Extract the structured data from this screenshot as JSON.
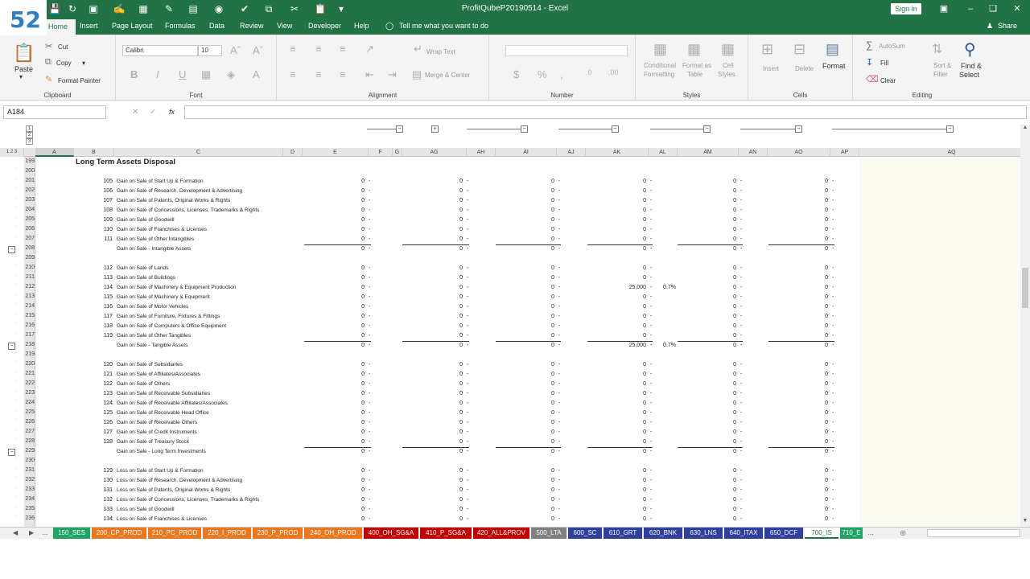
{
  "title": "ProfitQubeP20190514  -  Excel",
  "logo": "52",
  "signin_label": "Sign in",
  "share_label": "Share",
  "tell_me": "Tell me what you want to do",
  "ribbon_tabs": [
    "Home",
    "Insert",
    "Page Layout",
    "Formulas",
    "Data",
    "Review",
    "View",
    "Developer",
    "Help"
  ],
  "clipboard": {
    "paste": "Paste",
    "cut": "Cut",
    "copy": "Copy",
    "painter": "Format Painter",
    "label": "Clipboard"
  },
  "font": {
    "name": "Calibri",
    "size": "10",
    "label": "Font"
  },
  "alignment": {
    "wrap": "Wrap Text",
    "merge": "Merge & Center",
    "label": "Alignment"
  },
  "number": {
    "label": "Number"
  },
  "styles": {
    "cond": "Conditional",
    "cond2": "Formatting",
    "table": "Format as",
    "table2": "Table",
    "cell": "Cell",
    "cell2": "Styles",
    "label": "Styles"
  },
  "cells": {
    "insert": "Insert",
    "delete": "Delete",
    "format": "Format",
    "label": "Cells"
  },
  "editing": {
    "autosum": "AutoSum",
    "fill": "Fill",
    "clear": "Clear",
    "sort": "Sort &",
    "sort2": "Filter",
    "find": "Find &",
    "find2": "Select",
    "label": "Editing"
  },
  "namebox": "A184",
  "fx": "fx",
  "outline_levels_col": [
    "1",
    "2",
    "3"
  ],
  "outline_levels_row": [
    "1",
    "2",
    "3"
  ],
  "columns": [
    "A",
    "B",
    "C",
    "D",
    "E",
    "F",
    "G",
    "AG",
    "AH",
    "AI",
    "AJ",
    "AK",
    "AL",
    "AM",
    "AN",
    "AO",
    "AP",
    "AQ"
  ],
  "sheet_title": "Long Term Assets Disposal",
  "rows": [
    {
      "n": "199",
      "code": "",
      "label": "",
      "kind": "title"
    },
    {
      "n": "200",
      "code": "",
      "label": "",
      "kind": "blank"
    },
    {
      "n": "201",
      "code": "105",
      "label": "Gain on Sale of Start Up & Formation",
      "kind": "data"
    },
    {
      "n": "202",
      "code": "106",
      "label": "Gain on Sale of Research, Development & Advertising",
      "kind": "data"
    },
    {
      "n": "203",
      "code": "107",
      "label": "Gain on Sale of Patents, Original Works & Rights",
      "kind": "data"
    },
    {
      "n": "204",
      "code": "108",
      "label": "Gain on Sale of Concessions, Licenses, Trademarks & Rights",
      "kind": "data"
    },
    {
      "n": "205",
      "code": "109",
      "label": "Gain on Sale of Goodwill",
      "kind": "data"
    },
    {
      "n": "206",
      "code": "110",
      "label": "Gain on Sale of Franchises & Licenses",
      "kind": "data"
    },
    {
      "n": "207",
      "code": "111",
      "label": "Gain on Sale of Other Intangibles",
      "kind": "data"
    },
    {
      "n": "208",
      "code": "",
      "label": "Gain on Sale - Intangible Assets",
      "kind": "total"
    },
    {
      "n": "209",
      "code": "",
      "label": "",
      "kind": "blank"
    },
    {
      "n": "210",
      "code": "112",
      "label": "Gain on Sale of Lands",
      "kind": "data"
    },
    {
      "n": "211",
      "code": "113",
      "label": "Gain on Sale of Buildings",
      "kind": "data"
    },
    {
      "n": "212",
      "code": "114",
      "label": "Gain on Sale of Machinery & Equipment Production",
      "kind": "data",
      "ak": "25,000",
      "al": "0.7%"
    },
    {
      "n": "213",
      "code": "115",
      "label": "Gain on Sale of Machinery & Equipment",
      "kind": "data"
    },
    {
      "n": "214",
      "code": "116",
      "label": "Gain on Sale of Motor Vehicles",
      "kind": "data"
    },
    {
      "n": "215",
      "code": "117",
      "label": "Gain on Sale of Furniture, Fixtures & Fittings",
      "kind": "data"
    },
    {
      "n": "216",
      "code": "118",
      "label": "Gain on Sale of Computers & Office Equipment",
      "kind": "data"
    },
    {
      "n": "217",
      "code": "119",
      "label": "Gain on Sale of Other Tangibles",
      "kind": "data"
    },
    {
      "n": "218",
      "code": "",
      "label": "Gain on Sale - Tangible Assets",
      "kind": "total",
      "ak": "25,000",
      "al": "0.7%"
    },
    {
      "n": "219",
      "code": "",
      "label": "",
      "kind": "blank"
    },
    {
      "n": "220",
      "code": "120",
      "label": "Gain on Sale of Subsidiaries",
      "kind": "data"
    },
    {
      "n": "221",
      "code": "121",
      "label": "Gain on Sale of Affiliates/Associates",
      "kind": "data"
    },
    {
      "n": "222",
      "code": "122",
      "label": "Gain on Sale of Others",
      "kind": "data"
    },
    {
      "n": "223",
      "code": "123",
      "label": "Gain on Sale of Receivable Subsidiaries",
      "kind": "data"
    },
    {
      "n": "224",
      "code": "124",
      "label": "Gain on Sale of Receivable Affiliates/Associates",
      "kind": "data"
    },
    {
      "n": "225",
      "code": "125",
      "label": "Gain on Sale of Receivable Head Office",
      "kind": "data"
    },
    {
      "n": "226",
      "code": "126",
      "label": "Gain on Sale of Receivable Others",
      "kind": "data"
    },
    {
      "n": "227",
      "code": "127",
      "label": "Gain on Sale of Credit Instruments",
      "kind": "data"
    },
    {
      "n": "228",
      "code": "128",
      "label": "Gain on Sale of Treasury Stock",
      "kind": "data"
    },
    {
      "n": "229",
      "code": "",
      "label": "Gain on Sale - Long Term Investments",
      "kind": "total"
    },
    {
      "n": "230",
      "code": "",
      "label": "",
      "kind": "blank"
    },
    {
      "n": "231",
      "code": "129",
      "label": "Loss on Sale of Start Up & Formation",
      "kind": "data"
    },
    {
      "n": "232",
      "code": "130",
      "label": "Loss on Sale of Research, Development & Advertising",
      "kind": "data"
    },
    {
      "n": "233",
      "code": "131",
      "label": "Loss on Sale of Patents, Original Works & Rights",
      "kind": "data"
    },
    {
      "n": "234",
      "code": "132",
      "label": "Loss on Sale of Concessions, Licenses, Trademarks & Rights",
      "kind": "data"
    },
    {
      "n": "235",
      "code": "133",
      "label": "Loss on Sale of Goodwill",
      "kind": "data"
    },
    {
      "n": "236",
      "code": "134",
      "label": "Loss on Sale of Franchises & Licenses",
      "kind": "data"
    }
  ],
  "zero": "0",
  "dash": "-",
  "sheet_tabs": [
    {
      "label": "...",
      "color": "#f0f0f0",
      "text": "#333"
    },
    {
      "label": "150_SES",
      "color": "#21a366",
      "text": "#fff"
    },
    {
      "label": "200_CP_PROD",
      "color": "#e9781f",
      "text": "#fff"
    },
    {
      "label": "210_PC_PROD",
      "color": "#e9781f",
      "text": "#fff"
    },
    {
      "label": "220_I_PROD",
      "color": "#e9781f",
      "text": "#fff"
    },
    {
      "label": "230_P_PROD",
      "color": "#e9781f",
      "text": "#fff"
    },
    {
      "label": "240_OH_PROD",
      "color": "#e9781f",
      "text": "#fff"
    },
    {
      "label": "400_OH_SG&A",
      "color": "#c00000",
      "text": "#fff"
    },
    {
      "label": "410_P_SG&A",
      "color": "#c00000",
      "text": "#fff"
    },
    {
      "label": "420_ALL&PROV",
      "color": "#c00000",
      "text": "#fff"
    },
    {
      "label": "500_LTA",
      "color": "#808080",
      "text": "#fff"
    },
    {
      "label": "600_SC",
      "color": "#2e3f9c",
      "text": "#fff"
    },
    {
      "label": "610_GRT",
      "color": "#2e3f9c",
      "text": "#fff"
    },
    {
      "label": "620_BNK",
      "color": "#2e3f9c",
      "text": "#fff"
    },
    {
      "label": "630_LNS",
      "color": "#2e3f9c",
      "text": "#fff"
    },
    {
      "label": "640_ITAX",
      "color": "#2e3f9c",
      "text": "#fff"
    },
    {
      "label": "650_DCF",
      "color": "#2e3f9c",
      "text": "#fff"
    },
    {
      "label": "700_IS",
      "color": "#ffffff",
      "text": "#217346"
    },
    {
      "label": "710_E",
      "color": "#21a366",
      "text": "#fff"
    },
    {
      "label": "...",
      "color": "#f0f0f0",
      "text": "#333"
    }
  ],
  "colors": {
    "accent": "#217346"
  }
}
